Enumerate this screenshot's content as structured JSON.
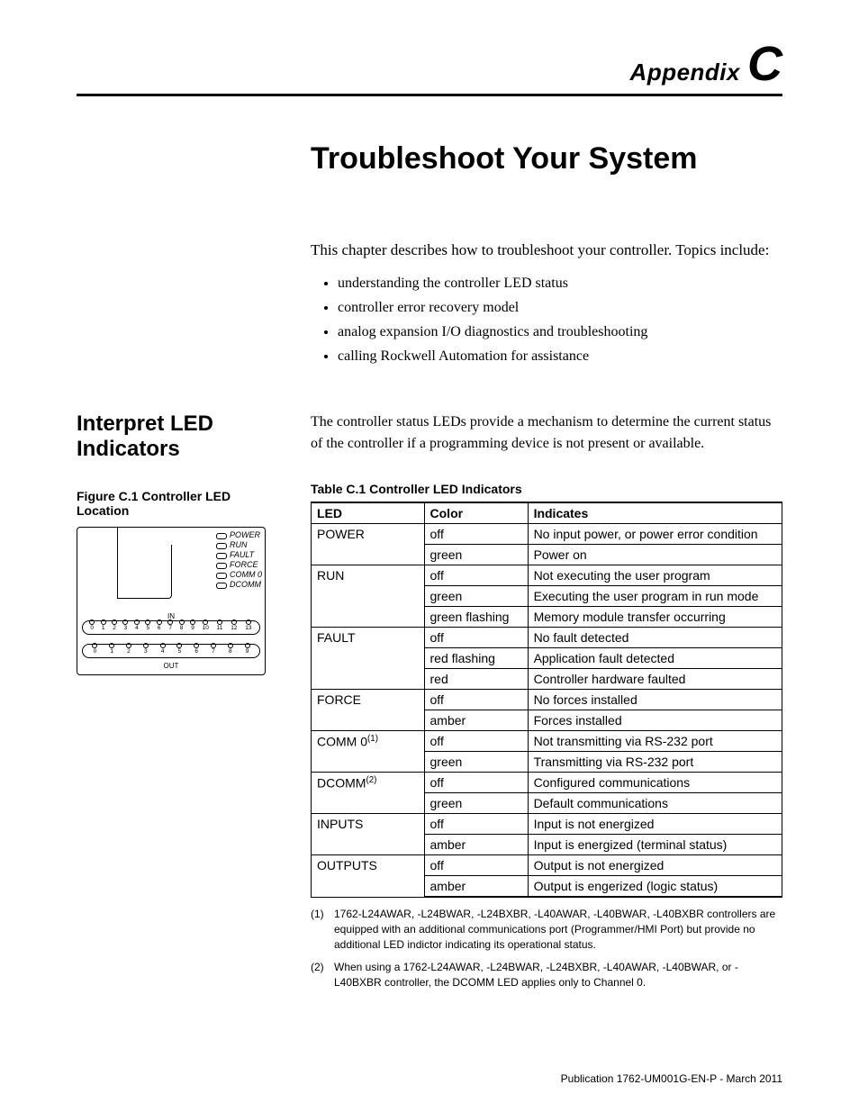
{
  "appendix": {
    "label": "Appendix",
    "letter": "C"
  },
  "title": "Troubleshoot Your System",
  "intro": {
    "text": "This chapter describes how to troubleshoot your controller. Topics include:",
    "bullets": [
      "understanding the controller LED status",
      "controller error recovery model",
      "analog expansion I/O diagnostics and troubleshooting",
      "calling Rockwell Automation for assistance"
    ]
  },
  "section": {
    "heading": "Interpret LED Indicators",
    "lead": "The controller status LEDs provide a mechanism to determine the current status of the controller if a programming device is not present or available."
  },
  "figure": {
    "caption": "Figure C.1 Controller LED Location",
    "led_labels": [
      "POWER",
      "RUN",
      "FAULT",
      "FORCE",
      "COMM 0",
      "DCOMM"
    ],
    "in_label": "IN",
    "out_label": "OUT",
    "in_numbers": [
      "0",
      "1",
      "2",
      "3",
      "4",
      "5",
      "6",
      "7",
      "8",
      "9",
      "10",
      "11",
      "12",
      "13"
    ],
    "out_numbers": [
      "0",
      "1",
      "2",
      "3",
      "4",
      "5",
      "6",
      "7",
      "8",
      "9"
    ]
  },
  "table": {
    "caption": "Table C.1 Controller LED Indicators",
    "headers": [
      "LED",
      "Color",
      "Indicates"
    ],
    "rows": [
      {
        "led": "POWER",
        "led_sup": "",
        "states": [
          {
            "color": "off",
            "indicates": "No input power, or power error condition"
          },
          {
            "color": "green",
            "indicates": "Power on"
          }
        ]
      },
      {
        "led": "RUN",
        "led_sup": "",
        "states": [
          {
            "color": "off",
            "indicates": "Not executing the user program"
          },
          {
            "color": "green",
            "indicates": "Executing the user program in run mode"
          },
          {
            "color": "green flashing",
            "indicates": "Memory module transfer occurring"
          }
        ]
      },
      {
        "led": "FAULT",
        "led_sup": "",
        "states": [
          {
            "color": "off",
            "indicates": "No fault detected"
          },
          {
            "color": "red flashing",
            "indicates": "Application fault detected"
          },
          {
            "color": "red",
            "indicates": "Controller hardware faulted"
          }
        ]
      },
      {
        "led": "FORCE",
        "led_sup": "",
        "states": [
          {
            "color": "off",
            "indicates": "No forces installed"
          },
          {
            "color": "amber",
            "indicates": "Forces installed"
          }
        ]
      },
      {
        "led": "COMM 0",
        "led_sup": "(1)",
        "states": [
          {
            "color": "off",
            "indicates": "Not transmitting via RS-232 port"
          },
          {
            "color": "green",
            "indicates": "Transmitting via RS-232 port"
          }
        ]
      },
      {
        "led": "DCOMM",
        "led_sup": "(2)",
        "states": [
          {
            "color": "off",
            "indicates": "Configured communications"
          },
          {
            "color": "green",
            "indicates": "Default communications"
          }
        ]
      },
      {
        "led": "INPUTS",
        "led_sup": "",
        "states": [
          {
            "color": "off",
            "indicates": "Input is not energized"
          },
          {
            "color": "amber",
            "indicates": "Input is energized (terminal status)"
          }
        ]
      },
      {
        "led": "OUTPUTS",
        "led_sup": "",
        "states": [
          {
            "color": "off",
            "indicates": "Output is not energized"
          },
          {
            "color": "amber",
            "indicates": "Output is engerized (logic status)"
          }
        ]
      }
    ],
    "footnotes": [
      {
        "num": "(1)",
        "text": "1762-L24AWAR, -L24BWAR, -L24BXBR, -L40AWAR, -L40BWAR, -L40BXBR controllers are equipped with an additional communications port (Programmer/HMI Port) but provide no additional LED indictor indicating its operational status."
      },
      {
        "num": "(2)",
        "text": "When using a 1762-L24AWAR, -L24BWAR, -L24BXBR, -L40AWAR, -L40BWAR, or -L40BXBR controller, the DCOMM LED applies only to Channel 0."
      }
    ]
  },
  "publication": "Publication 1762-UM001G-EN-P - March 2011"
}
